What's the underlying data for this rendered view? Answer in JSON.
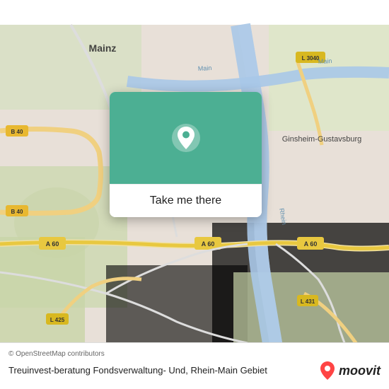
{
  "map": {
    "attribution": "© OpenStreetMap contributors",
    "location_name": "Treuinvest-beratung Fondsverwaltung- Und, Rhein-Main Gebiet",
    "button_label": "Take me there",
    "moovit_label": "moovit",
    "bg_color": "#e8e0d8",
    "water_color": "#a8c8e8",
    "green_color": "#c8d8a8",
    "card_bg": "#4CAF93"
  }
}
